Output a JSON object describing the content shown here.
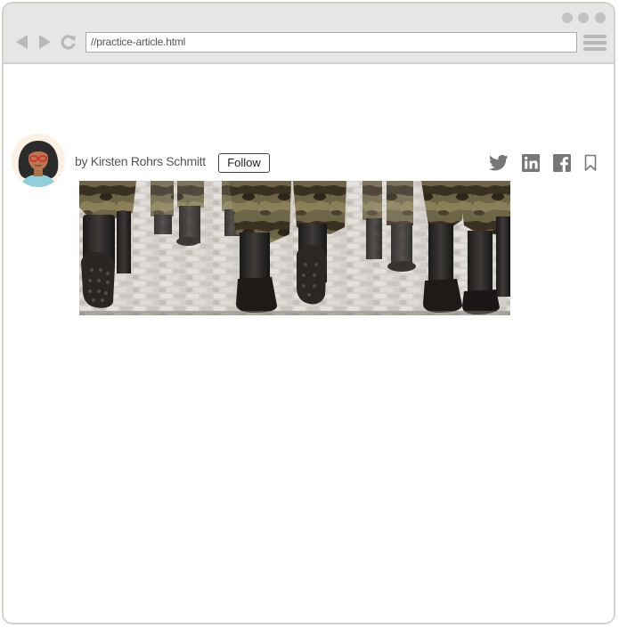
{
  "browser": {
    "url": "//practice-article.html",
    "icons": {
      "back": "back-arrow-icon",
      "forward": "forward-arrow-icon",
      "reload": "reload-icon",
      "menu": "hamburger-menu-icon"
    },
    "window_dots": 3
  },
  "article": {
    "byline": "by Kirsten Rohrs Schmitt",
    "follow_label": "Follow",
    "social_icons": [
      "twitter-icon",
      "linkedin-icon",
      "facebook-icon",
      "bookmark-icon"
    ],
    "hero_image": "marching-soldiers-boots-photo"
  },
  "colors": {
    "chrome_bg": "#e6e6e6",
    "icon_gray": "#b9b9b9",
    "social_gray": "#777777",
    "text_gray": "#555555"
  }
}
